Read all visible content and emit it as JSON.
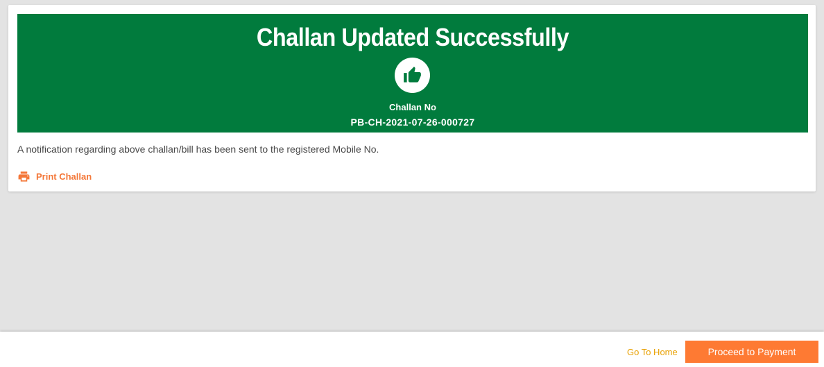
{
  "banner": {
    "title": "Challan Updated Successfully",
    "icon": "thumbs-up-icon",
    "challan_label": "Challan No",
    "challan_number": "PB-CH-2021-07-26-000727",
    "color": "#017b3d"
  },
  "notification_text": "A notification regarding above challan/bill has been sent to the registered Mobile No.",
  "print_link": {
    "icon": "printer-icon",
    "label": "Print Challan",
    "color": "#f47738"
  },
  "footer": {
    "go_home_label": "Go To Home",
    "proceed_label": "Proceed to Payment",
    "proceed_color": "#fe7a33"
  }
}
